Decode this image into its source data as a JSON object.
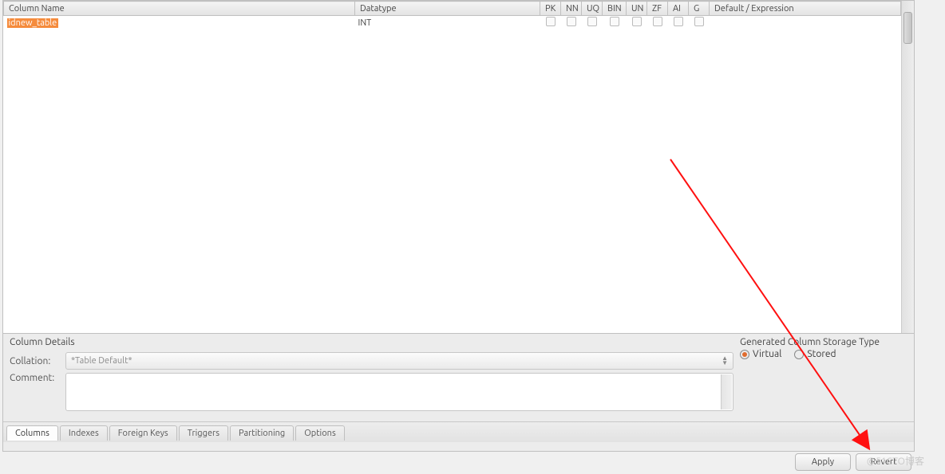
{
  "columns_grid": {
    "headers": {
      "column_name": "Column Name",
      "datatype": "Datatype",
      "pk": "PK",
      "nn": "NN",
      "uq": "UQ",
      "bin": "BIN",
      "un": "UN",
      "zf": "ZF",
      "ai": "AI",
      "g": "G",
      "default": "Default / Expression"
    },
    "rows": [
      {
        "name": "idnew_table",
        "datatype": "INT",
        "pk": false,
        "nn": false,
        "uq": false,
        "bin": false,
        "un": false,
        "zf": false,
        "ai": false,
        "g": false,
        "default": ""
      }
    ]
  },
  "details": {
    "heading": "Column Details",
    "collation_label": "Collation:",
    "collation_value": "*Table Default*",
    "comment_label": "Comment:",
    "comment_value": ""
  },
  "generated": {
    "heading": "Generated Column Storage Type",
    "virtual_label": "Virtual",
    "stored_label": "Stored",
    "selected": "virtual"
  },
  "tabs": {
    "columns": "Columns",
    "indexes": "Indexes",
    "foreign_keys": "Foreign Keys",
    "triggers": "Triggers",
    "partitioning": "Partitioning",
    "options": "Options",
    "active": "columns"
  },
  "buttons": {
    "apply": "Apply",
    "revert": "Revert"
  },
  "watermark": "@51CTO博客"
}
